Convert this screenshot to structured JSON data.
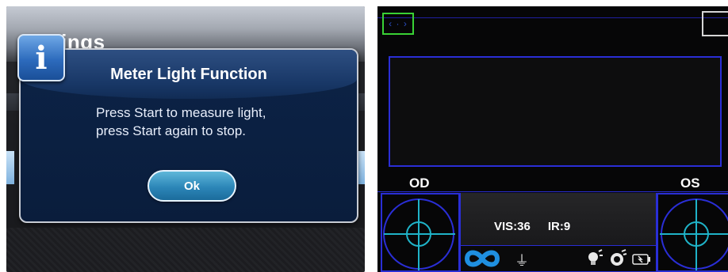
{
  "left_screen": {
    "background_title": "tings",
    "dialog": {
      "title": "Meter Light Function",
      "message_line1": "Press Start to measure light,",
      "message_line2": "press Start again to stop.",
      "ok_label": "Ok",
      "info_glyph": "i"
    }
  },
  "right_screen": {
    "top_left_button_glyph": "‹ · ›",
    "od_label": "OD",
    "os_label": "OS",
    "readouts": {
      "vis": "VIS:36",
      "ir": "IR:9"
    },
    "status_icons": [
      "infinity-icon",
      "usb-icon",
      "bulb-icon",
      "camera-icon",
      "battery-icon"
    ],
    "usb_glyph": "⏚"
  },
  "colors": {
    "dialog_bg": "#0c2347",
    "ok_button": "#2c86b8",
    "frame_blue": "#2a2ed6",
    "green_frame": "#39d235",
    "crosshair": "#1fb3c8",
    "infinity": "#1f8fe0"
  }
}
